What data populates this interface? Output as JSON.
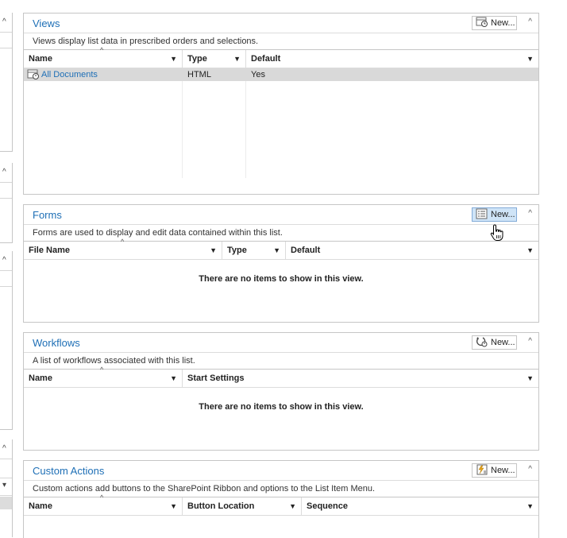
{
  "left_strip": {
    "carets": [
      "^",
      "^",
      "^",
      "^"
    ],
    "dropdown": "▾"
  },
  "views": {
    "title": "Views",
    "new_label": "New...",
    "description": "Views display list data in prescribed orders and selections.",
    "columns": [
      "Name",
      "Type",
      "Default"
    ],
    "rows": [
      {
        "name": "All Documents",
        "type": "HTML",
        "default": "Yes"
      }
    ]
  },
  "forms": {
    "title": "Forms",
    "new_label": "New...",
    "description": "Forms are used to display and edit data contained within this list.",
    "columns": [
      "File Name",
      "Type",
      "Default"
    ],
    "empty_message": "There are no items to show in this view."
  },
  "workflows": {
    "title": "Workflows",
    "new_label": "New...",
    "description": "A list of workflows associated with this list.",
    "columns": [
      "Name",
      "Start Settings"
    ],
    "empty_message": "There are no items to show in this view."
  },
  "custom_actions": {
    "title": "Custom Actions",
    "new_label": "New...",
    "description": "Custom actions add buttons to the SharePoint Ribbon and options to the List Item Menu.",
    "columns": [
      "Name",
      "Button Location",
      "Sequence"
    ]
  },
  "colors": {
    "title_blue": "#1e6fb6",
    "selected_row": "#d9d9d9",
    "hover_button": "#cfe4f7"
  }
}
